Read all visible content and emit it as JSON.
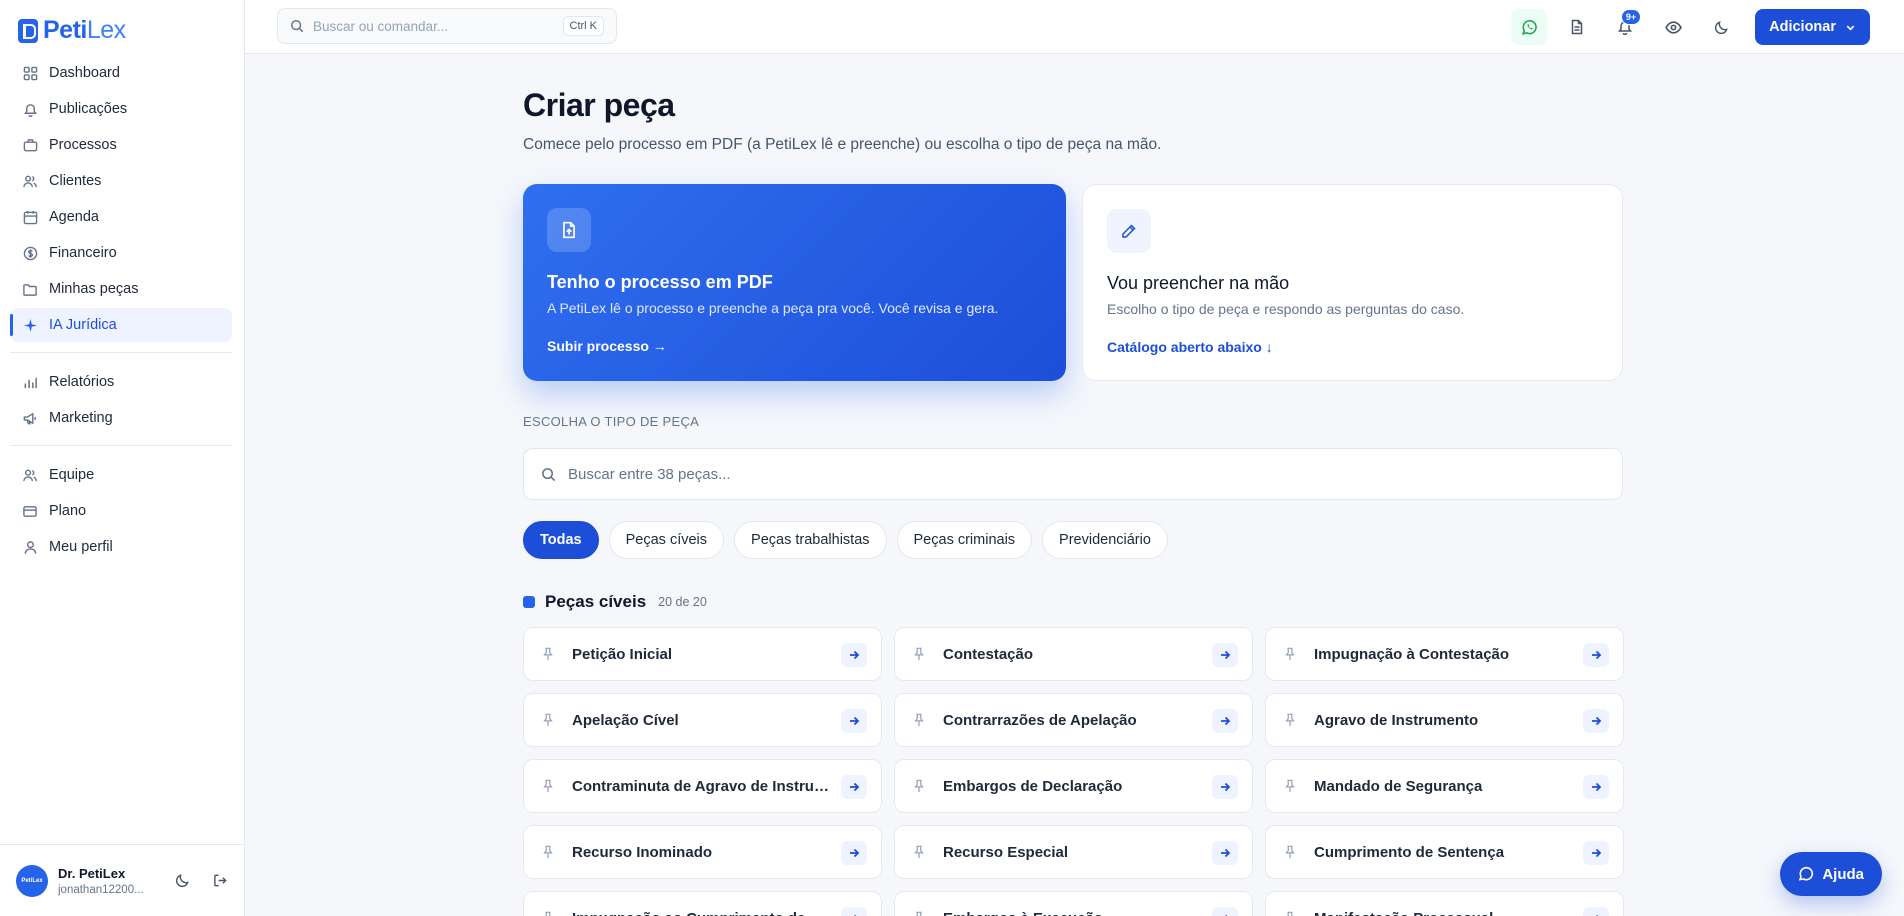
{
  "brand": {
    "name_a": "Peti",
    "name_b": "Lex",
    "avatar_text": "PetiLex"
  },
  "sidebar": {
    "items": [
      {
        "label": "Dashboard",
        "icon": "grid-icon"
      },
      {
        "label": "Publicações",
        "icon": "bell-icon"
      },
      {
        "label": "Processos",
        "icon": "briefcase-icon"
      },
      {
        "label": "Clientes",
        "icon": "users-icon"
      },
      {
        "label": "Agenda",
        "icon": "calendar-icon"
      },
      {
        "label": "Financeiro",
        "icon": "coin-icon"
      },
      {
        "label": "Minhas peças",
        "icon": "folder-icon"
      },
      {
        "label": "IA Jurídica",
        "icon": "sparkle-icon"
      }
    ],
    "items2": [
      {
        "label": "Relatórios",
        "icon": "bar-chart-icon"
      },
      {
        "label": "Marketing",
        "icon": "megaphone-icon"
      }
    ],
    "items3": [
      {
        "label": "Equipe",
        "icon": "team-icon"
      },
      {
        "label": "Plano",
        "icon": "credit-card-icon"
      },
      {
        "label": "Meu perfil",
        "icon": "user-icon"
      }
    ],
    "user": {
      "name": "Dr. PetiLex",
      "email": "jonathan12200..."
    }
  },
  "topbar": {
    "search_placeholder": "Buscar ou comandar...",
    "shortcut": "Ctrl K",
    "notifications_badge": "9+",
    "add_label": "Adicionar"
  },
  "main": {
    "title": "Criar peça",
    "subtitle": "Comece pelo processo em PDF (a PetiLex lê e preenche) ou escolha o tipo de peça na mão.",
    "card_pdf": {
      "title": "Tenho o processo em PDF",
      "desc": "A PetiLex lê o processo e preenche a peça pra você. Você revisa e gera.",
      "link": "Subir processo →"
    },
    "card_hand": {
      "title": "Vou preencher na mão",
      "desc": "Escolho o tipo de peça e respondo as perguntas do caso.",
      "link": "Catálogo aberto abaixo ↓"
    },
    "section_label": "ESCOLHA O TIPO DE PEÇA",
    "catalog_placeholder": "Buscar entre 38 peças...",
    "filters": [
      "Todas",
      "Peças cíveis",
      "Peças trabalhistas",
      "Peças criminais",
      "Previdenciário"
    ],
    "group": {
      "title": "Peças cíveis",
      "count": "20 de 20"
    },
    "pieces": [
      "Petição Inicial",
      "Contestação",
      "Impugnação à Contestação",
      "Apelação Cível",
      "Contrarrazões de Apelação",
      "Agravo de Instrumento",
      "Contraminuta de Agravo de Instrumento",
      "Embargos de Declaração",
      "Mandado de Segurança",
      "Recurso Inominado",
      "Recurso Especial",
      "Cumprimento de Sentença",
      "Impugnação ao Cumprimento de Sentença",
      "Embargos à Execução",
      "Manifestação Processual"
    ]
  },
  "help_label": "Ajuda",
  "colors": {
    "accent": "#1d4ed8",
    "accent_light": "#2563eb",
    "whatsapp": "#16a34a"
  }
}
